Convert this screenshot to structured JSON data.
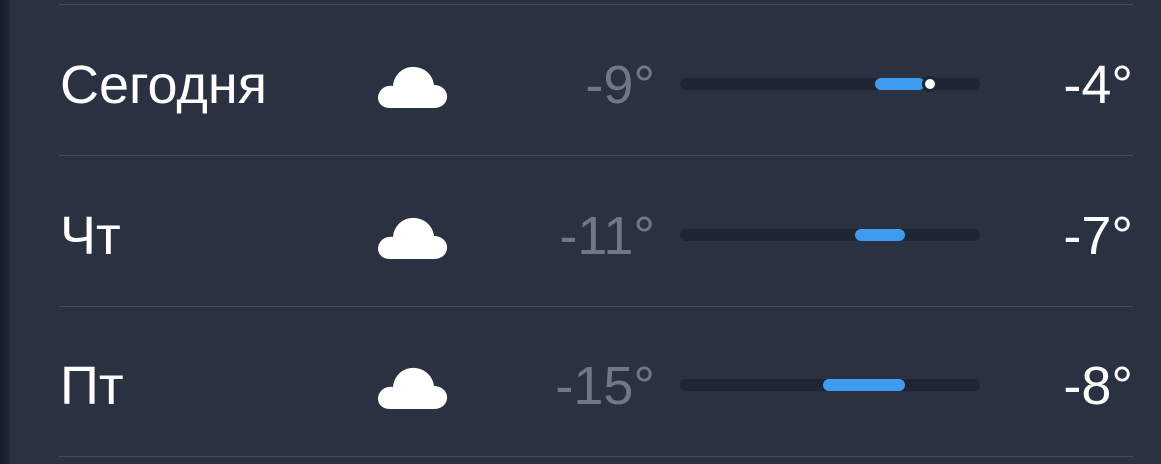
{
  "forecast": {
    "scale_min": -15,
    "scale_max": -3,
    "rows": [
      {
        "day": "Сегодня",
        "icon": "cloud-icon",
        "low": "-9°",
        "high": "-4°",
        "low_value": -9,
        "high_value": -4,
        "fill_start": -7.2,
        "fill_end": -5.2,
        "current_marker": true,
        "current_value": -5.0
      },
      {
        "day": "Чт",
        "icon": "cloud-icon",
        "low": "-11°",
        "high": "-7°",
        "low_value": -11,
        "high_value": -7,
        "fill_start": -8.0,
        "fill_end": -6.0,
        "current_marker": false
      },
      {
        "day": "Пт",
        "icon": "cloud-icon",
        "low": "-15°",
        "high": "-8°",
        "low_value": -15,
        "high_value": -8,
        "fill_start": -9.3,
        "fill_end": -6.0,
        "current_marker": false
      }
    ]
  },
  "colors": {
    "background": "#2a3140",
    "bar_track": "#1f2532",
    "bar_fill": "#3d9bf0",
    "low_text": "#727883",
    "high_text": "#ffffff"
  }
}
